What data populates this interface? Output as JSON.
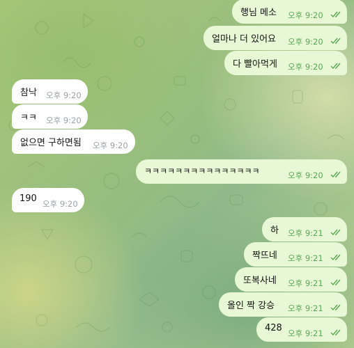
{
  "chat": {
    "messages": [
      {
        "text": "행님 메소",
        "time": "오후 9:20",
        "direction": "outgoing",
        "status_icon": "double-check-icon"
      },
      {
        "text": "얼마나 더 있어요",
        "time": "오후 9:20",
        "direction": "outgoing",
        "status_icon": "double-check-icon"
      },
      {
        "text": "다 빨아먹게",
        "time": "오후 9:20",
        "direction": "outgoing",
        "status_icon": "double-check-icon"
      },
      {
        "text": "참낙",
        "time": "오후 9:20",
        "direction": "incoming"
      },
      {
        "text": "ㅋㅋ",
        "time": "오후 9:20",
        "direction": "incoming"
      },
      {
        "text": "없으면 구하면됨",
        "time": "오후 9:20",
        "direction": "incoming"
      },
      {
        "text": "ㅋㅋㅋㅋㅋㅋㅋㅋㅋㅋㅋㅋㅋㅋㅋ",
        "time": "오후 9:20",
        "direction": "outgoing",
        "status_icon": "double-check-icon"
      },
      {
        "text": "190",
        "time": "오후 9:20",
        "direction": "incoming"
      },
      {
        "text": "하",
        "time": "오후 9:21",
        "direction": "outgoing",
        "status_icon": "double-check-icon"
      },
      {
        "text": "짝뜨네",
        "time": "오후 9:21",
        "direction": "outgoing",
        "status_icon": "double-check-icon"
      },
      {
        "text": "또복사네",
        "time": "오후 9:21",
        "direction": "outgoing",
        "status_icon": "double-check-icon"
      },
      {
        "text": "올인 짝 강승",
        "time": "오후 9:21",
        "direction": "outgoing",
        "status_icon": "double-check-icon"
      },
      {
        "text": "428",
        "time": "오후 9:21",
        "direction": "outgoing",
        "status_icon": "double-check-icon"
      }
    ]
  },
  "colors": {
    "outgoing_bubble": "#e8f8d6",
    "incoming_bubble": "#ffffff",
    "outgoing_time": "#59a753",
    "incoming_time": "#9aa1a6"
  }
}
